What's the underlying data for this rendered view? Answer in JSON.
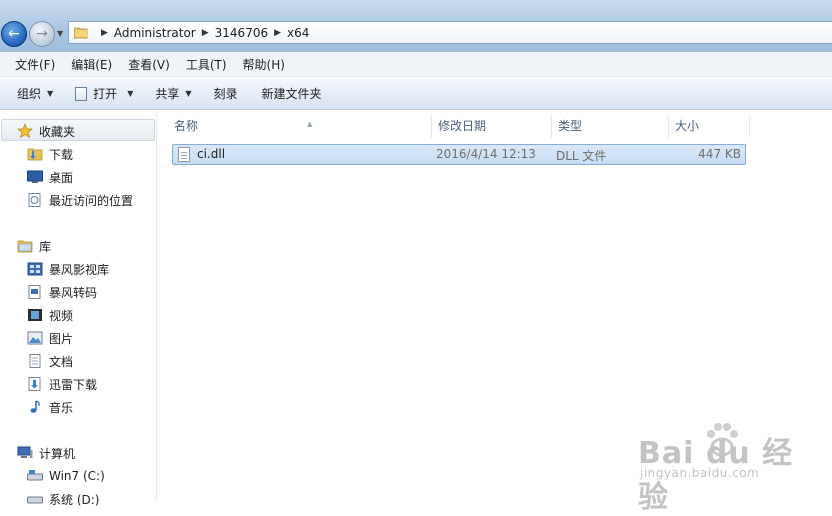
{
  "address": {
    "crumbs": [
      "Administrator",
      "3146706",
      "x64"
    ]
  },
  "menu": [
    "文件(F)",
    "编辑(E)",
    "查看(V)",
    "工具(T)",
    "帮助(H)"
  ],
  "commands": {
    "organize": "组织",
    "open": "打开",
    "share": "共享",
    "burn": "刻录",
    "new_folder": "新建文件夹"
  },
  "nav": {
    "favorites": "收藏夹",
    "downloads": "下载",
    "desktop": "桌面",
    "recent": "最近访问的位置",
    "libraries": "库",
    "baofeng_video": "暴风影视库",
    "baofeng_convert": "暴风转码",
    "videos": "视频",
    "pictures": "图片",
    "documents": "文档",
    "xunlei": "迅雷下载",
    "music": "音乐",
    "computer": "计算机",
    "drive_c": "Win7 (C:)",
    "drive_d": "系统 (D:)"
  },
  "columns": {
    "name": "名称",
    "modified": "修改日期",
    "type": "类型",
    "size": "大小"
  },
  "files": [
    {
      "name": "ci.dll",
      "modified": "2016/4/14 12:13",
      "type": "DLL 文件",
      "size": "447 KB"
    }
  ],
  "watermark": {
    "main": "Bai du 经验",
    "sub": "jingyan.baidu.com"
  },
  "colors": {
    "selection": "#c6dcf4",
    "selection_border": "#84acd9",
    "header_text": "#4c607a"
  }
}
